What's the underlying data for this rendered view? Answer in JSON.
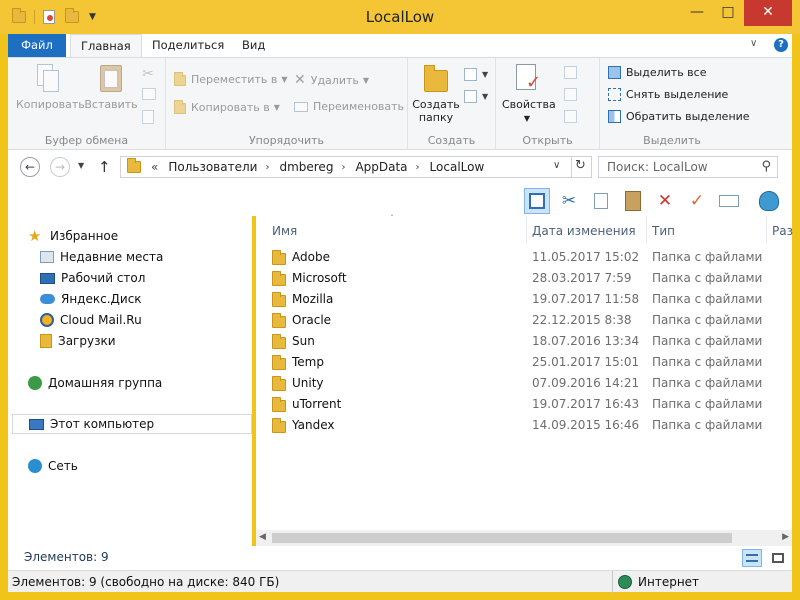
{
  "window": {
    "title": "LocalLow"
  },
  "tabs": {
    "file": "Файл",
    "home": "Главная",
    "share": "Поделиться",
    "view": "Вид"
  },
  "ribbon": {
    "clipboard": {
      "label": "Буфер обмена",
      "copy": "Копировать",
      "paste": "Вставить"
    },
    "organize": {
      "label": "Упорядочить",
      "move": "Переместить в",
      "copyto": "Копировать в",
      "delete": "Удалить",
      "rename": "Переименовать"
    },
    "create": {
      "label": "Создать",
      "newfolder_line1": "Создать",
      "newfolder_line2": "папку"
    },
    "open": {
      "label": "Открыть",
      "properties": "Свойства"
    },
    "select": {
      "label": "Выделить",
      "select_all": "Выделить все",
      "select_none": "Снять выделение",
      "invert": "Обратить выделение"
    }
  },
  "address": {
    "prefix": "«",
    "crumbs": [
      "Пользователи",
      "dmbereg",
      "AppData",
      "LocalLow"
    ],
    "search_placeholder": "Поиск: LocalLow"
  },
  "nav": {
    "favorites": "Избранное",
    "recent": "Недавние места",
    "desktop": "Рабочий стол",
    "yadisk": "Яндекс.Диск",
    "cloudmail": "Cloud Mail.Ru",
    "downloads": "Загрузки",
    "homegroup": "Домашняя группа",
    "computer": "Этот компьютер",
    "network": "Сеть"
  },
  "columns": {
    "name": "Имя",
    "date": "Дата изменения",
    "type": "Тип",
    "size": "Раз"
  },
  "files": [
    {
      "name": "Adobe",
      "date": "11.05.2017 15:02",
      "type": "Папка с файлами"
    },
    {
      "name": "Microsoft",
      "date": "28.03.2017 7:59",
      "type": "Папка с файлами"
    },
    {
      "name": "Mozilla",
      "date": "19.07.2017 11:58",
      "type": "Папка с файлами"
    },
    {
      "name": "Oracle",
      "date": "22.12.2015 8:38",
      "type": "Папка с файлами"
    },
    {
      "name": "Sun",
      "date": "18.07.2016 13:34",
      "type": "Папка с файлами"
    },
    {
      "name": "Temp",
      "date": "25.01.2017 15:01",
      "type": "Папка с файлами"
    },
    {
      "name": "Unity",
      "date": "07.09.2016 14:21",
      "type": "Папка с файлами"
    },
    {
      "name": "uTorrent",
      "date": "19.07.2017 16:43",
      "type": "Папка с файлами"
    },
    {
      "name": "Yandex",
      "date": "14.09.2015 16:46",
      "type": "Папка с файлами"
    }
  ],
  "status": {
    "count": "Элементов: 9",
    "bottom": "Элементов: 9 (свободно на диске: 840 ГБ)",
    "zone": "Интернет"
  },
  "colors": {
    "accent": "#1c6fc1",
    "title_bg": "#f4c534",
    "close": "#c7392e",
    "folder": "#e9b93e"
  }
}
